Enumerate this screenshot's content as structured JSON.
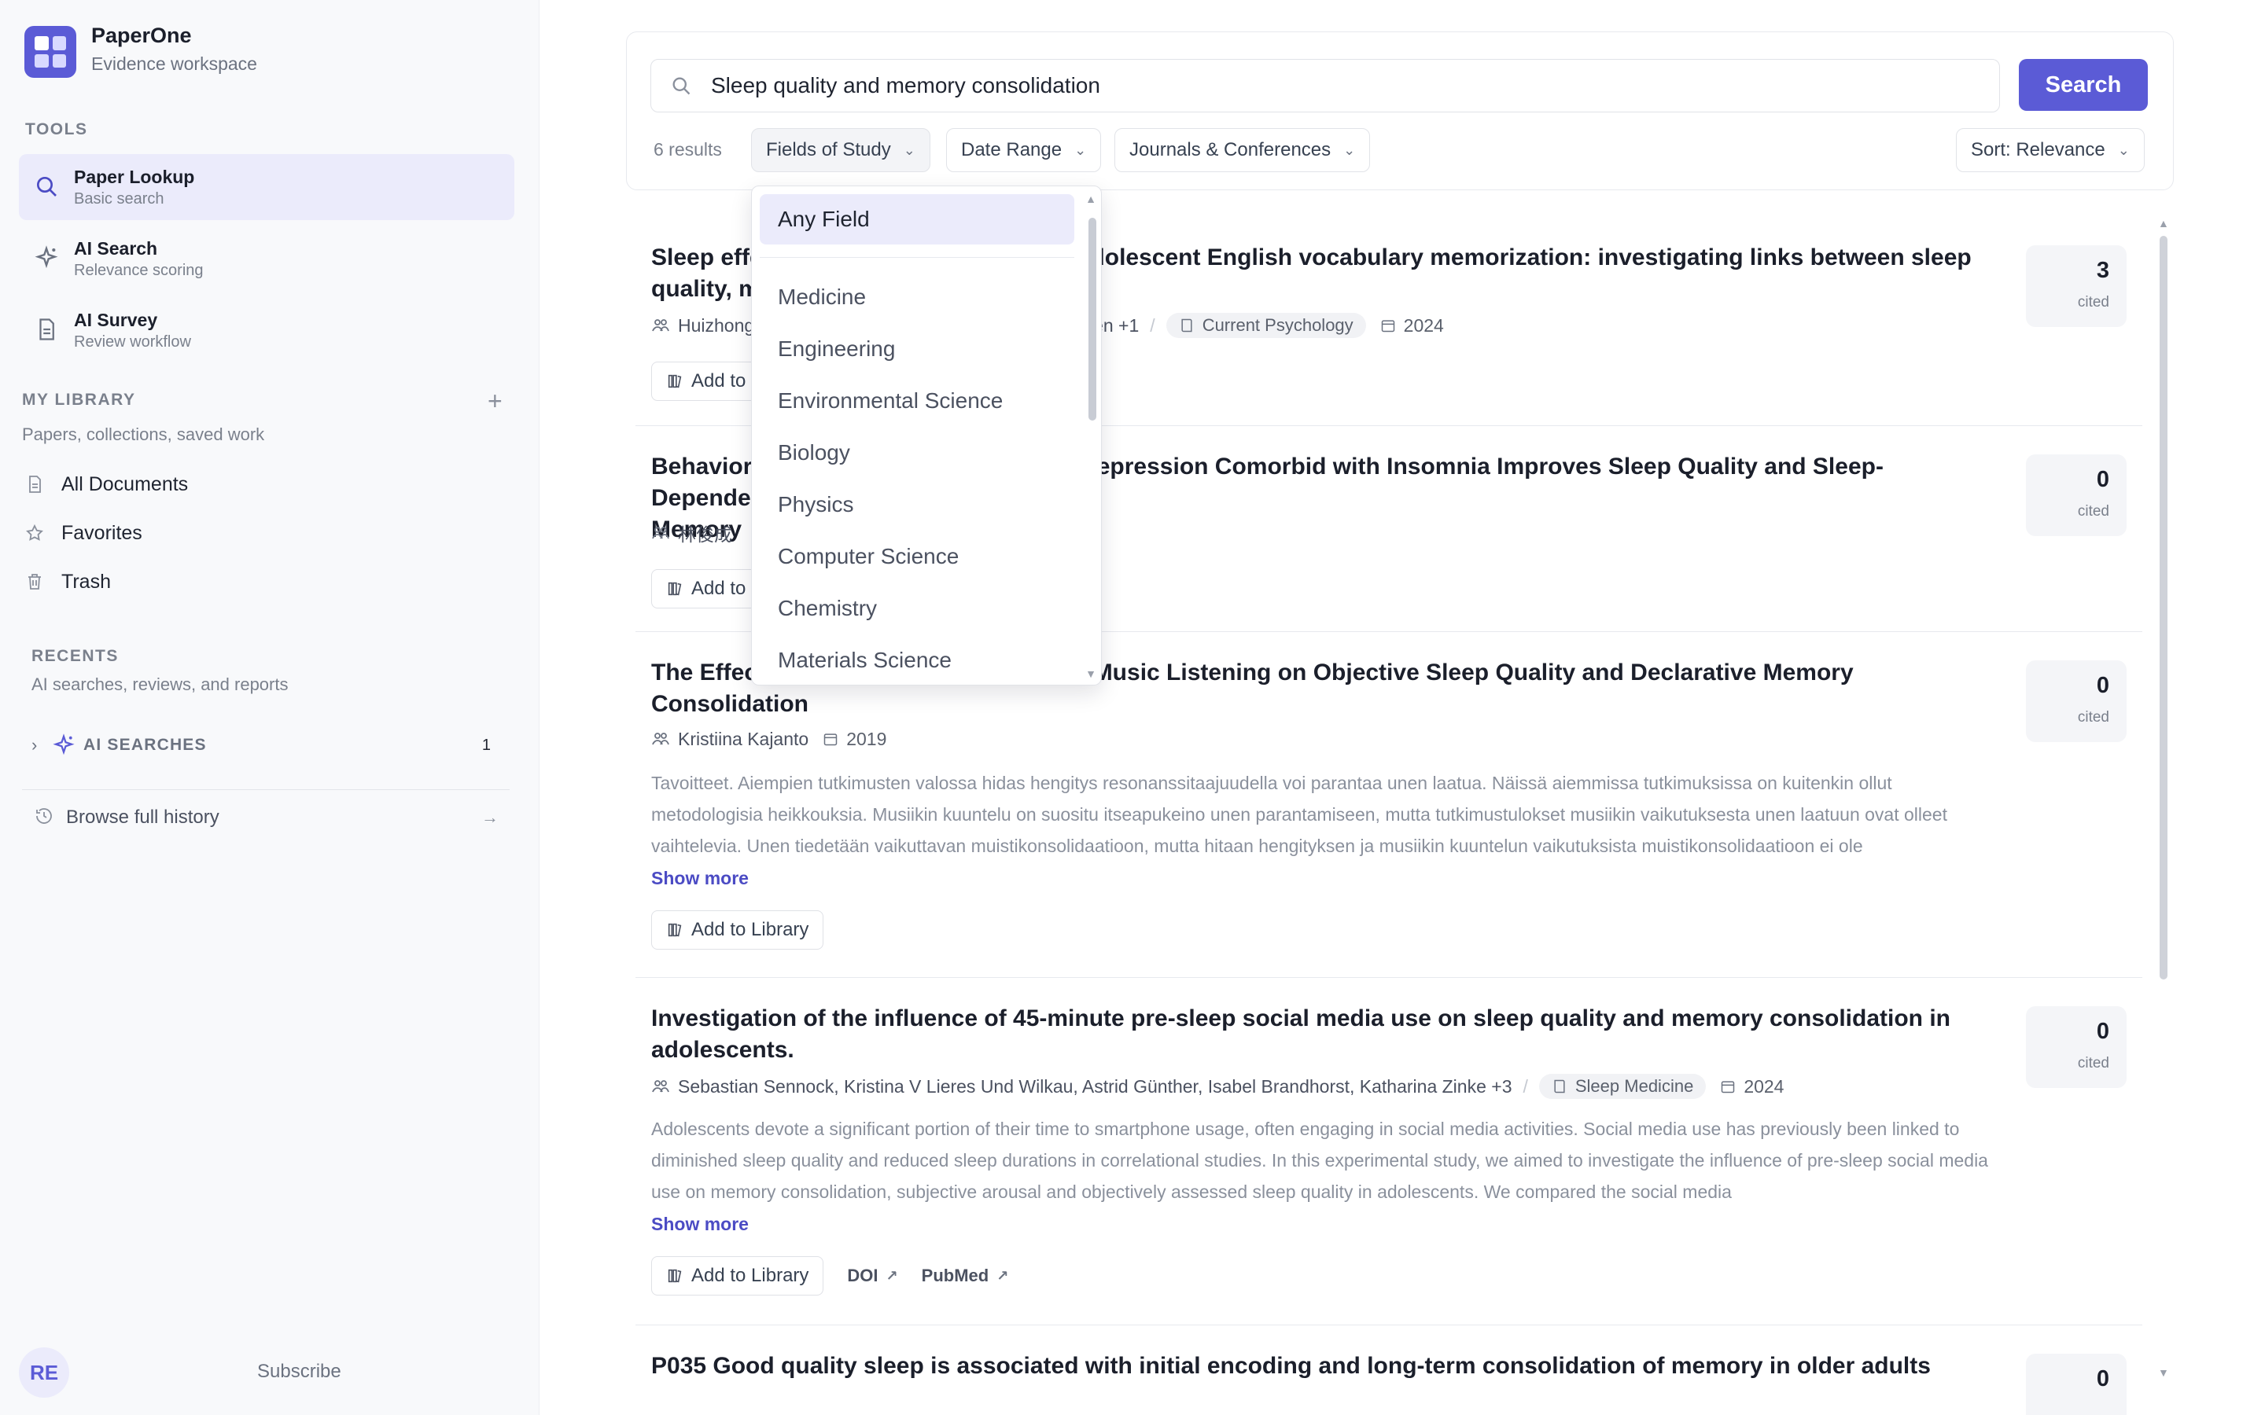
{
  "app": {
    "name": "PaperOne",
    "subtitle": "Evidence workspace"
  },
  "sidebar": {
    "tools_label": "TOOLS",
    "tools": [
      {
        "title": "Paper Lookup",
        "sub": "Basic search",
        "icon": "search-icon",
        "active": true
      },
      {
        "title": "AI Search",
        "sub": "Relevance scoring",
        "icon": "sparkle-icon",
        "active": false
      },
      {
        "title": "AI Survey",
        "sub": "Review workflow",
        "icon": "document-icon",
        "active": false
      }
    ],
    "library_label": "MY LIBRARY",
    "library_desc": "Papers, collections, saved work",
    "library_items": [
      {
        "label": "All Documents",
        "icon": "document-icon"
      },
      {
        "label": "Favorites",
        "icon": "star-icon"
      },
      {
        "label": "Trash",
        "icon": "trash-icon"
      }
    ],
    "recents_label": "RECENTS",
    "recents_desc": "AI searches, reviews, and reports",
    "ai_searches_label": "AI SEARCHES",
    "ai_searches_count": "1",
    "history_label": "Browse full history",
    "avatar_initials": "RE",
    "subscribe_label": "Subscribe"
  },
  "search": {
    "query": "Sleep quality and memory consolidation",
    "button_label": "Search",
    "results_count": "6 results",
    "filters": {
      "fields": "Fields of Study",
      "date": "Date Range",
      "journals": "Journals & Conferences",
      "sort": "Sort: Relevance"
    }
  },
  "dropdown": {
    "selected": "Any Field",
    "options": [
      "Medicine",
      "Engineering",
      "Environmental Science",
      "Biology",
      "Physics",
      "Computer Science",
      "Chemistry",
      "Materials Science"
    ]
  },
  "results": [
    {
      "title": "Sleep effe…adolescent English vocabulary memorization: investigating links between sleep quality, m",
      "title_left": "Sleep effe",
      "title_right": "adolescent English vocabulary memorization: investigating links between sleep",
      "title_line2": "quality, m",
      "authors_left": "Huizhong",
      "authors_right": "i Chen +1",
      "venue": "Current Psychology",
      "year": "2024",
      "add_label": "Add to",
      "cited": "3",
      "cited_label": "cited"
    },
    {
      "title_right": "Depression Comorbid with Insomnia Improves Sleep Quality and Sleep-Dependent",
      "title_left": "Behaviora",
      "title_line2": "Memory",
      "authors_left": "林俊成",
      "add_label": "Add to",
      "cited": "0",
      "cited_label": "cited"
    },
    {
      "title_left": "The Effec",
      "title_right": "d Music Listening on Objective Sleep Quality and Declarative Memory",
      "title_line2": "Consolidation",
      "authors": "Kristiina Kajanto",
      "year": "2019",
      "abstract": "Tavoitteet. Aiempien tutkimusten valossa hidas hengitys resonanssitaajuudella voi parantaa unen laatua. Näissä aiemmissa tutkimuksissa on kuitenkin ollut metodologisia heikkouksia. Musiikin kuuntelu on suositu itseapukeino unen parantamiseen, mutta tutkimustulokset musiikin vaikutuksesta unen laatuun ovat olleet vaihtelevia. Unen tiedetään vaikuttavan muistikonsolidaatioon, mutta hitaan hengityksen ja musiikin kuuntelun vaikutuksista muistikonsolidaatioon ei ole",
      "show_more": "Show more",
      "add_label": "Add to Library",
      "cited": "0",
      "cited_label": "cited"
    },
    {
      "title": "Investigation of the influence of 45-minute pre-sleep social media use on sleep quality and memory consolidation in adolescents.",
      "authors": "Sebastian Sennock, Kristina V Lieres Und Wilkau, Astrid Günther, Isabel Brandhorst, Katharina Zinke +3",
      "venue": "Sleep Medicine",
      "year": "2024",
      "abstract": "Adolescents devote a significant portion of their time to smartphone usage, often engaging in social media activities. Social media use has previously been linked to diminished sleep quality and reduced sleep durations in correlational studies. In this experimental study, we aimed to investigate the influence of pre-sleep social media use on memory consolidation, subjective arousal and objectively assessed sleep quality in adolescents. We compared the social media",
      "show_more": "Show more",
      "add_label": "Add to Library",
      "doi_label": "DOI",
      "pubmed_label": "PubMed",
      "cited": "0",
      "cited_label": "cited"
    },
    {
      "title": "P035 Good quality sleep is associated with initial encoding and long-term consolidation of memory in older adults",
      "cited": "0"
    }
  ]
}
